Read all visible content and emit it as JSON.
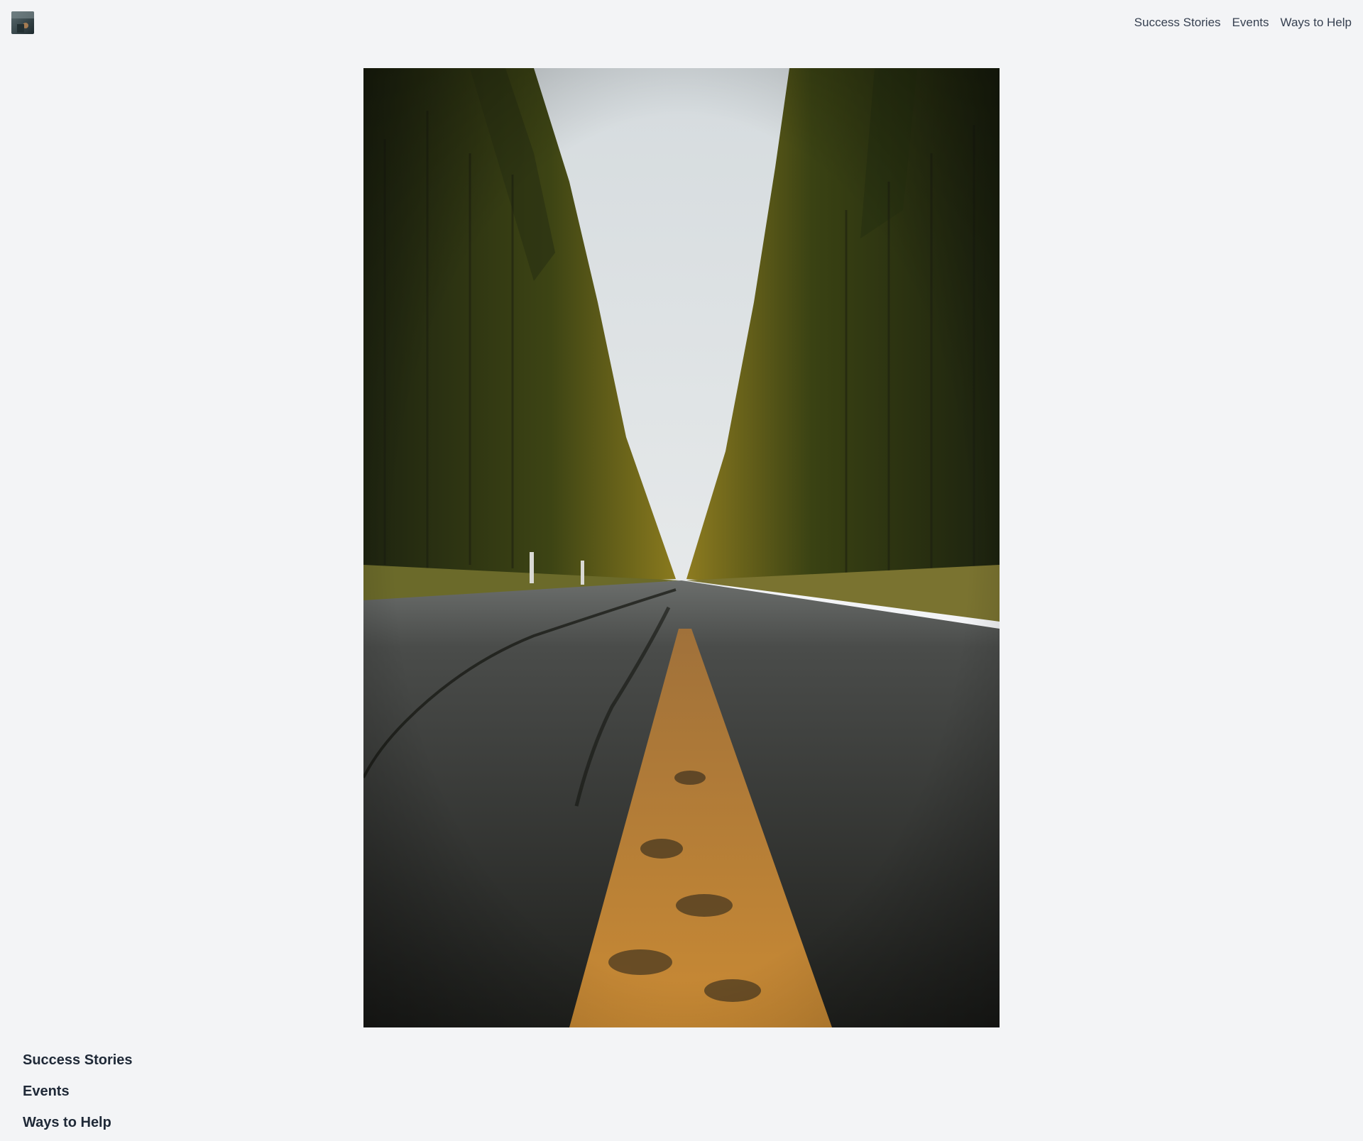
{
  "header": {
    "logo_icon": "site-logo-photo-icon",
    "nav": [
      {
        "label": "Success Stories"
      },
      {
        "label": "Events"
      },
      {
        "label": "Ways to Help"
      }
    ]
  },
  "hero": {
    "image": "forest-road-photo",
    "colors": {
      "sky": "#dde2e4",
      "trees": "#3a3f14",
      "road": "#3a3b38",
      "center_line": "#c8852e"
    }
  },
  "sections": [
    {
      "heading": "Success Stories"
    },
    {
      "heading": "Events"
    },
    {
      "heading": "Ways to Help"
    }
  ],
  "page": {
    "background": "#f3f4f6"
  }
}
